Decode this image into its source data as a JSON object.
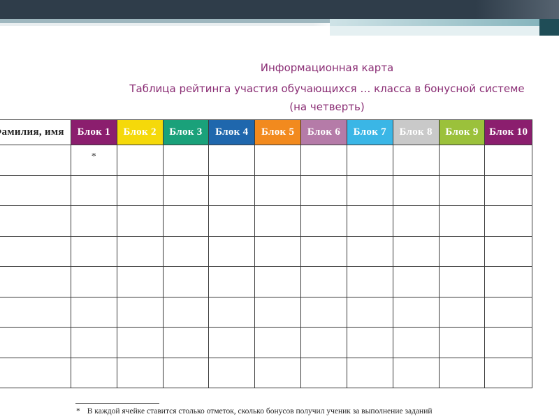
{
  "titles": {
    "line1": "Информационная карта",
    "line2": "Таблица рейтинга участия обучающихся … класса в бонусной системе",
    "line3": "(на четверть)"
  },
  "table": {
    "name_header": "Фамилия, имя",
    "blocks": [
      {
        "label": "Блок 1",
        "color": "#8b1e6e"
      },
      {
        "label": "Блок 2",
        "color": "#f5d90a"
      },
      {
        "label": "Блок 3",
        "color": "#1aa17a"
      },
      {
        "label": "Блок 4",
        "color": "#1f67ad"
      },
      {
        "label": "Блок 5",
        "color": "#f28a1e"
      },
      {
        "label": "Блок 6",
        "color": "#b57ba8"
      },
      {
        "label": "Блок 7",
        "color": "#3ab6e6"
      },
      {
        "label": "Блок 8",
        "color": "#c9c9c9"
      },
      {
        "label": "Блок 9",
        "color": "#9bc13b"
      },
      {
        "label": "Блок 10",
        "color": "#8b1e6e"
      }
    ],
    "row_count": 8,
    "first_cell_mark": "*"
  },
  "footnote": {
    "star": "*",
    "text": "В каждой ячейке ставится столько отметок, сколько бонусов получил ученик за выполнение заданий"
  }
}
